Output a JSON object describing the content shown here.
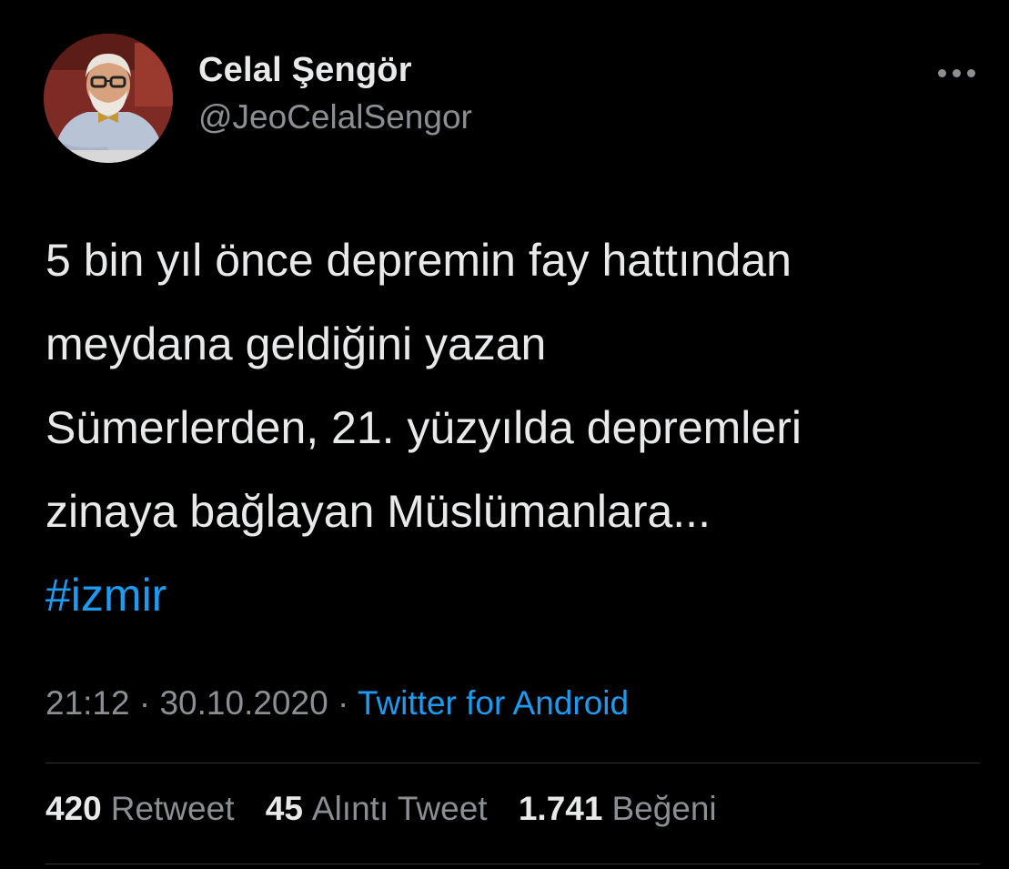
{
  "author": {
    "name": "Celal Şengör",
    "handle": "@JeoCelalSengor",
    "avatar_icon": "profile-photo"
  },
  "tweet": {
    "lines": [
      "5 bin yıl önce depremin fay hattından",
      "meydana geldiğini yazan",
      "Sümerlerden, 21. yüzyılda depremleri",
      "zinaya bağlayan Müslümanlara..."
    ],
    "hashtag": "#izmir"
  },
  "meta": {
    "time": "21:12",
    "separator1": " · ",
    "date": "30.10.2020",
    "separator2": " · ",
    "source": "Twitter for Android"
  },
  "stats": {
    "retweets": {
      "count": "420",
      "label": "Retweet"
    },
    "quotes": {
      "count": "45",
      "label": "Alıntı Tweet"
    },
    "likes": {
      "count": "1.741",
      "label": "Beğeni"
    }
  },
  "colors": {
    "background": "#000000",
    "text": "#e7e9ea",
    "muted": "#8b8f94",
    "accent": "#1d9bf0",
    "divider": "#2f3336"
  },
  "icons": {
    "more": "more-horizontal-icon"
  }
}
